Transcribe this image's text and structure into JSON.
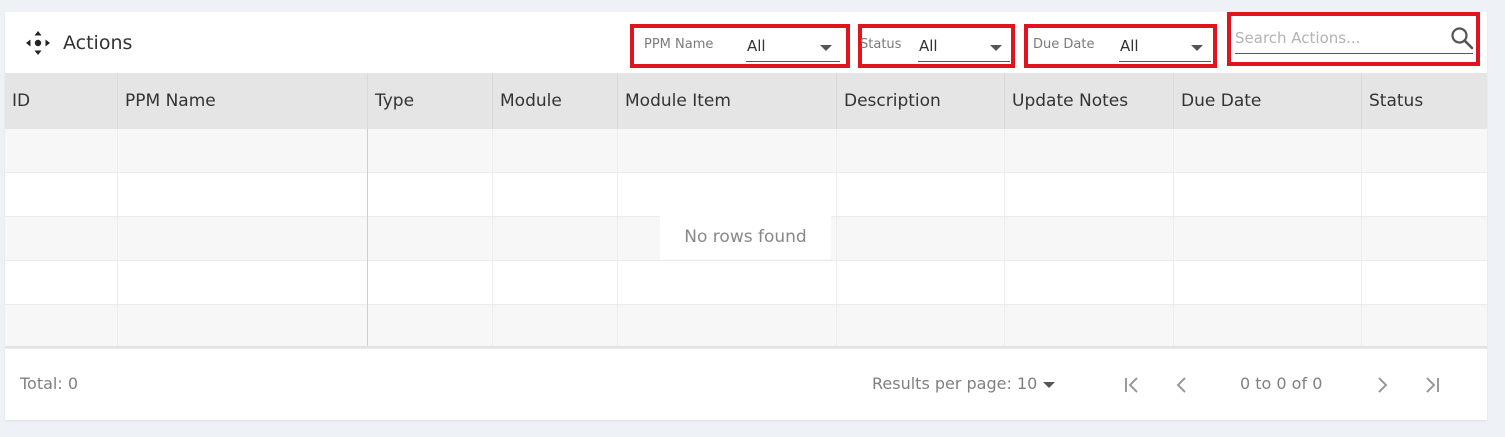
{
  "header": {
    "title": "Actions",
    "filters": {
      "ppm_name": {
        "label": "PPM Name",
        "value": "All"
      },
      "status": {
        "label": "Status",
        "value": "All"
      },
      "due_date": {
        "label": "Due Date",
        "value": "All"
      }
    },
    "search": {
      "placeholder": "Search Actions...",
      "value": ""
    }
  },
  "table": {
    "columns": [
      "ID",
      "PPM Name",
      "Type",
      "Module",
      "Module Item",
      "Description",
      "Update Notes",
      "Due Date",
      "Status"
    ],
    "empty_message": "No rows found"
  },
  "footer": {
    "total": "Total: 0",
    "results_per_page": "Results per page: 10",
    "page_info": "0 to 0 of 0"
  },
  "colors": {
    "highlight_border": "#e0141e",
    "header_bg": "#e5e5e5",
    "alt_row_bg": "#f7f7f7"
  },
  "icons": [
    "move-icon",
    "chevron-down-icon",
    "search-icon",
    "first-page-icon",
    "previous-page-icon",
    "next-page-icon",
    "last-page-icon"
  ]
}
